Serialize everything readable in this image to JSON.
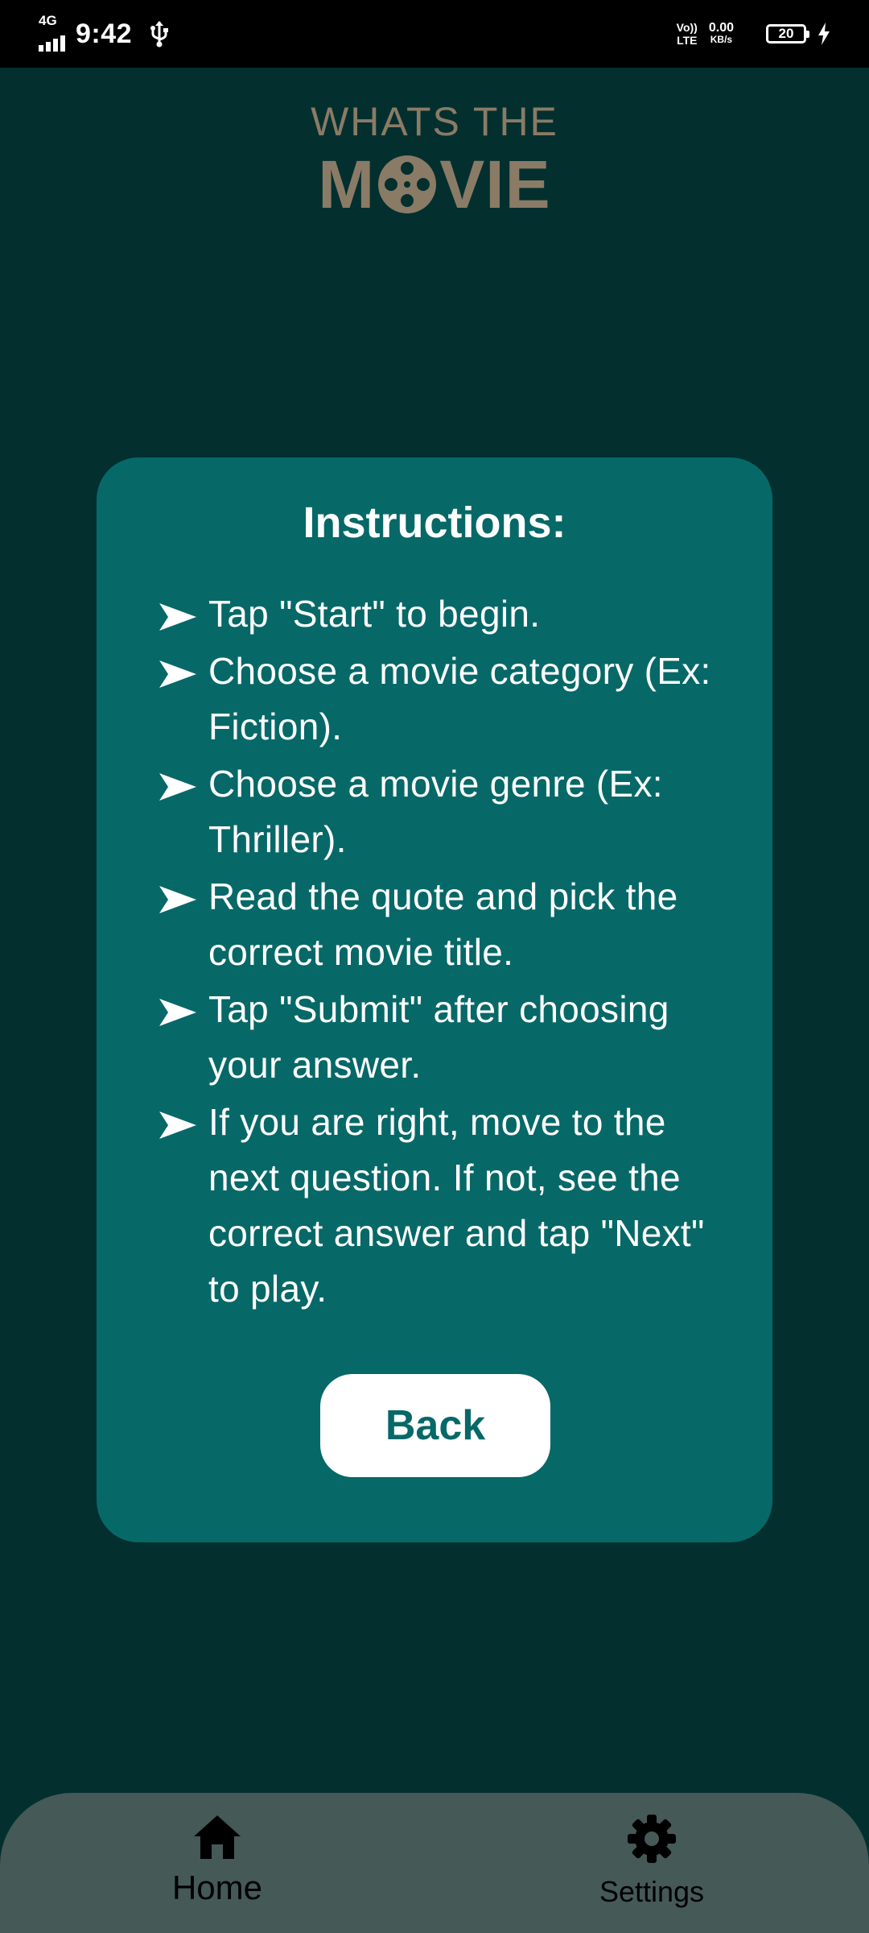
{
  "status_bar": {
    "network_type": "4G",
    "time": "9:42",
    "volte_top": "Vo))",
    "volte_bottom": "LTE",
    "speed_value": "0.00",
    "speed_unit": "KB/s",
    "battery_level": "20"
  },
  "logo": {
    "line1": "WHATS THE",
    "letter_m": "M",
    "letters_vie": "VIE",
    "color": "#8a7b66"
  },
  "instructions": {
    "title": "Instructions:",
    "items": [
      "Tap \"Start\" to begin.",
      "Choose a movie category (Ex: Fiction).",
      "Choose a movie genre (Ex: Thriller).",
      "Read the quote and pick the correct movie title.",
      "Tap \"Submit\" after choosing your answer.",
      "If you are right, move to the next question. If not, see the correct answer and tap \"Next\" to play."
    ],
    "back_label": "Back"
  },
  "bottom_nav": {
    "home_label": "Home",
    "settings_label": "Settings",
    "home_icon": "home-icon",
    "settings_icon": "gear-icon"
  },
  "colors": {
    "background": "#032f2f",
    "card": "#076868",
    "nav_bar": "#455957",
    "button": "#ffffff"
  }
}
